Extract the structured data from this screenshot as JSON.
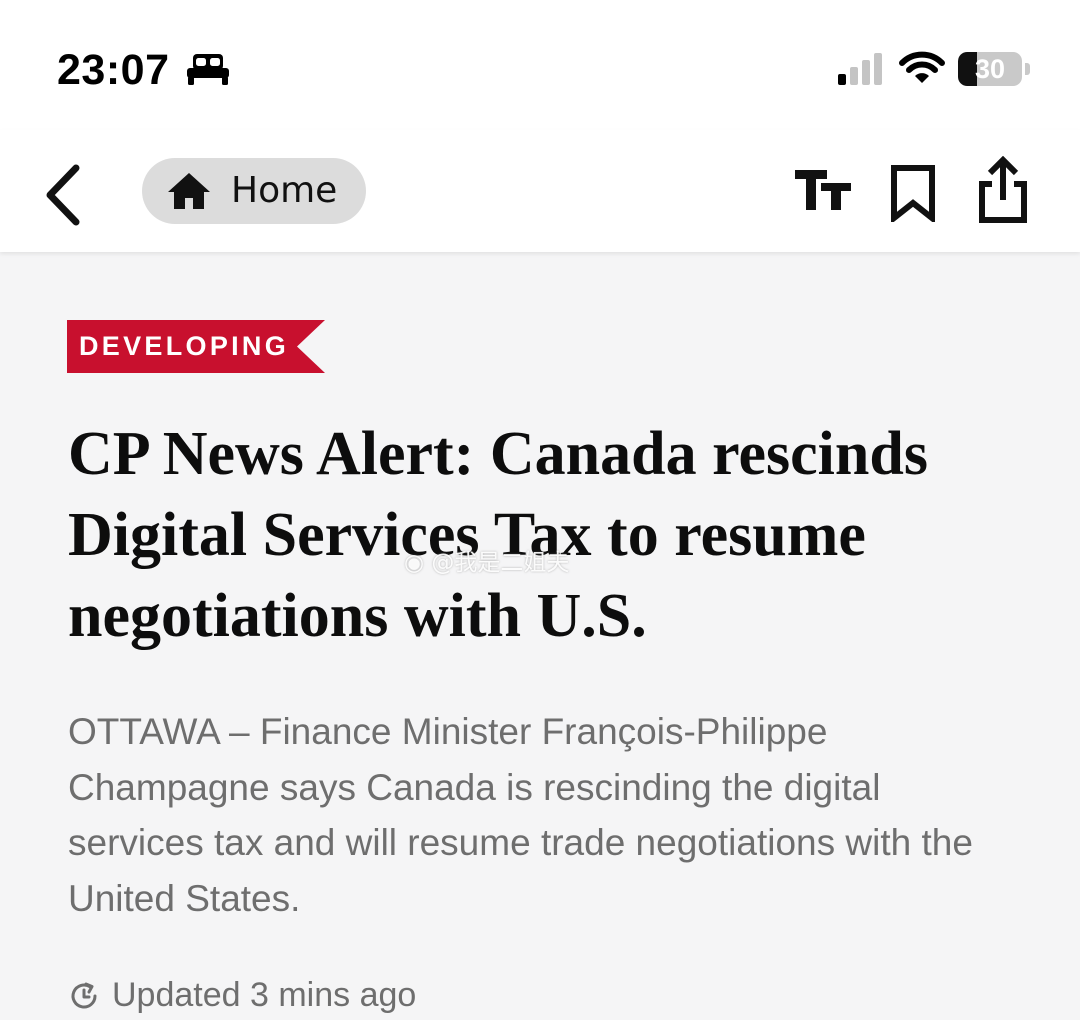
{
  "status_bar": {
    "time": "23:07",
    "focus_icon": "bed-icon",
    "signal_icon": "cellular-signal-icon",
    "signal_bars_active": 1,
    "signal_bars_total": 4,
    "wifi_icon": "wifi-icon",
    "battery_level": "30",
    "battery_fraction": 0.3
  },
  "nav": {
    "back_icon": "chevron-left-icon",
    "home_label": "Home",
    "home_icon": "house-icon",
    "text_size_icon": "text-size-icon",
    "bookmark_icon": "bookmark-icon",
    "share_icon": "share-icon"
  },
  "article": {
    "tag": "DEVELOPING",
    "headline": "CP News Alert: Canada rescinds Digital Services Tax to resume negotiations with U.S.",
    "summary": "OTTAWA – Finance Minister François-Philippe Champagne says Canada is rescinding the digital services tax and will resume trade negotiations with the United States.",
    "updated": "Updated 3 mins ago",
    "updated_icon": "refresh-clock-icon"
  },
  "watermark": {
    "text": "@我是二姐夫",
    "icon": "weibo-logo-icon"
  },
  "colors": {
    "tag_red": "#c8102e",
    "summary_gray": "#6e6e6e",
    "pill_gray": "#dcdcdc",
    "page_background": "#f5f5f6"
  }
}
